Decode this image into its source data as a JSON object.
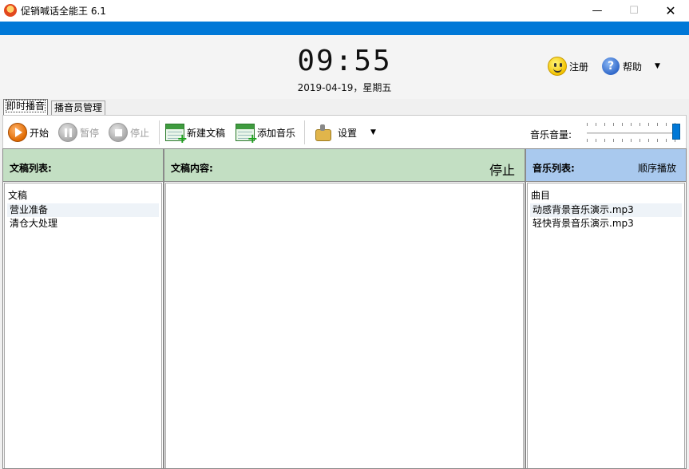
{
  "window": {
    "title": "促销喊话全能王 6.1",
    "min": "—",
    "max": "☐",
    "close": "✕"
  },
  "header": {
    "time": "09:55",
    "date": "2019-04-19，星期五",
    "register_label": "注册",
    "help_label": "帮助"
  },
  "tabs": [
    {
      "label": "即时播音",
      "active": true
    },
    {
      "label": "播音员管理",
      "active": false
    }
  ],
  "toolbar": {
    "start_label": "开始",
    "pause_label": "暂停",
    "stop_label": "停止",
    "new_script_label": "新建文稿",
    "add_music_label": "添加音乐",
    "settings_label": "设置",
    "volume_label": "音乐音量:",
    "volume_level": 1.0
  },
  "scripts": {
    "title": "文稿列表:",
    "column": "文稿",
    "items": [
      "营业准备",
      "清仓大处理"
    ]
  },
  "content": {
    "title": "文稿内容:",
    "status": "停止"
  },
  "music": {
    "title": "音乐列表:",
    "mode": "顺序播放",
    "column": "曲目",
    "items": [
      "动感背景音乐演示.mp3",
      "轻快背景音乐演示.mp3"
    ]
  },
  "colors": {
    "accent": "#0078d7",
    "panel_green": "#c3dfc3",
    "panel_blue": "#a9c9ee"
  }
}
